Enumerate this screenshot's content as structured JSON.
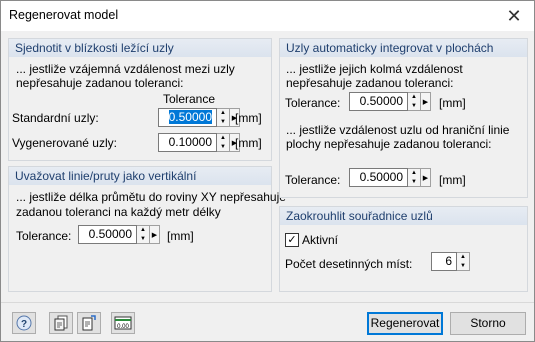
{
  "dialog": {
    "title": "Regenerovat model"
  },
  "group1": {
    "header": "Sjednotit v blízkosti ležící uzly",
    "desc1": "... jestliže vzájemná vzdálenost mezi uzly",
    "desc2": "nepřesahuje zadanou toleranci:",
    "column_header": "Tolerance",
    "standard_label": "Standardní uzly:",
    "standard_value": "0.50000",
    "standard_unit": "[mm]",
    "generated_label": "Vygenerované uzly:",
    "generated_value": "0.10000",
    "generated_unit": "[mm]"
  },
  "group2": {
    "header": "Uvažovat linie/pruty jako vertikální",
    "desc1": "... jestliže délka průmětu do roviny XY nepřesahuje",
    "desc2": "zadanou toleranci na každý metr délky",
    "tolerance_label": "Tolerance:",
    "tolerance_value": "0.50000",
    "tolerance_unit": "[mm]"
  },
  "group3": {
    "header": "Uzly automaticky integrovat v plochách",
    "desc1": "... jestliže jejich kolmá vzdálenost",
    "desc2": "nepřesahuje zadanou toleranci:",
    "tolerance1_label": "Tolerance:",
    "tolerance1_value": "0.50000",
    "tolerance1_unit": "[mm]",
    "desc3": "... jestliže vzdálenost uzlu od hraniční linie",
    "desc4": "plochy nepřesahuje zadanou toleranci:",
    "tolerance2_label": "Tolerance:",
    "tolerance2_value": "0.50000",
    "tolerance2_unit": "[mm]"
  },
  "group4": {
    "header": "Zaokrouhlit souřadnice uzlů",
    "active_label": "Aktivní",
    "active_checked": true,
    "decimals_label": "Počet desetinných míst:",
    "decimals_value": "6"
  },
  "footer": {
    "regenerate_label": "Regenerovat",
    "cancel_label": "Storno",
    "units_icon_text": "0.00"
  },
  "colors": {
    "group_header_text": "#1f3f6e",
    "selection": "#0078d7",
    "default_button_border": "#0078d7"
  }
}
